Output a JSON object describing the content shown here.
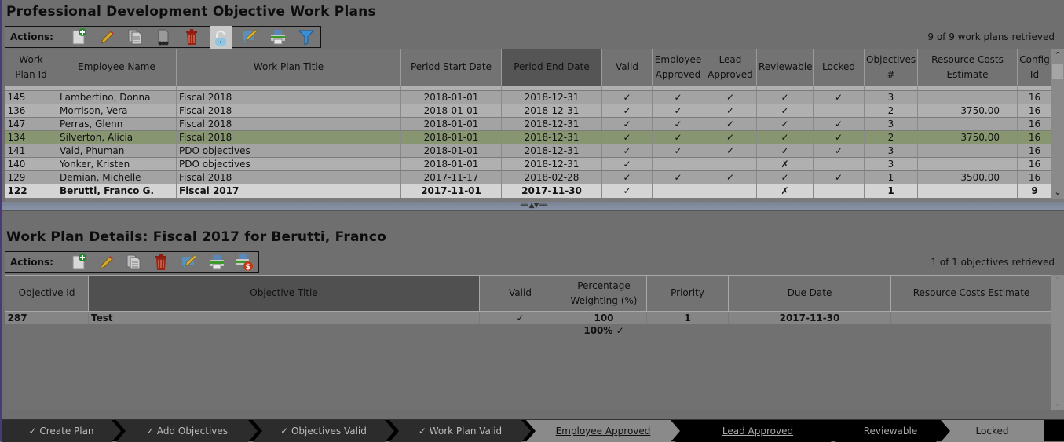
{
  "top": {
    "title": "Professional Development Objective Work Plans",
    "actions_label": "Actions:",
    "toolbar": [
      {
        "icon": "add-document-icon",
        "label": "Add"
      },
      {
        "icon": "pencil-icon",
        "label": "Edit"
      },
      {
        "icon": "copy-document-icon",
        "label": "Copy"
      },
      {
        "icon": "bulk-copy-icon",
        "label": "Bulk Copy"
      },
      {
        "icon": "trash-icon",
        "label": "Delete"
      },
      {
        "icon": "unlock-icon",
        "label": "Unlock"
      },
      {
        "icon": "comment-edit-icon",
        "label": "Review"
      },
      {
        "icon": "printer-icon",
        "label": "Print"
      },
      {
        "icon": "filter-icon",
        "label": "Filter"
      }
    ],
    "status": "9 of 9 work plans retrieved",
    "columns": [
      "Work Plan Id",
      "Employee Name",
      "Work Plan Title",
      "Period Start Date",
      "Period End Date",
      "Valid",
      "Employee Approved",
      "Lead Approved",
      "Reviewable",
      "Locked",
      "Objectives #",
      "Resource Costs Estimate",
      "Config Id"
    ],
    "sorted_column": "Period End Date",
    "rows": [
      {
        "id": "145",
        "name": "Lambertino, Donna",
        "title": "Fiscal 2018",
        "start": "2018-01-01",
        "end": "2018-12-31",
        "valid": "✓",
        "emp": "✓",
        "lead": "✓",
        "review": "✓",
        "locked": "✓",
        "obj": "3",
        "cost": "",
        "config": "16"
      },
      {
        "id": "136",
        "name": "Morrison, Vera",
        "title": "Fiscal 2018",
        "start": "2018-01-01",
        "end": "2018-12-31",
        "valid": "✓",
        "emp": "✓",
        "lead": "✓",
        "review": "✓",
        "locked": "",
        "obj": "2",
        "cost": "3750.00",
        "config": "16"
      },
      {
        "id": "147",
        "name": "Perras, Glenn",
        "title": "Fiscal 2018",
        "start": "2018-01-01",
        "end": "2018-12-31",
        "valid": "✓",
        "emp": "✓",
        "lead": "✓",
        "review": "✓",
        "locked": "✓",
        "obj": "3",
        "cost": "",
        "config": "16"
      },
      {
        "id": "134",
        "name": "Silverton, Alicia",
        "title": "Fiscal 2018",
        "start": "2018-01-01",
        "end": "2018-12-31",
        "valid": "✓",
        "emp": "✓",
        "lead": "✓",
        "review": "✓",
        "locked": "✓",
        "obj": "2",
        "cost": "3750.00",
        "config": "16"
      },
      {
        "id": "141",
        "name": "Vaid, Phuman",
        "title": "PDO objectives",
        "start": "2018-01-01",
        "end": "2018-12-31",
        "valid": "✓",
        "emp": "✓",
        "lead": "✓",
        "review": "✓",
        "locked": "✓",
        "obj": "3",
        "cost": "",
        "config": "16"
      },
      {
        "id": "140",
        "name": "Yonker, Kristen",
        "title": "PDO objectives",
        "start": "2018-01-01",
        "end": "2018-12-31",
        "valid": "✓",
        "emp": "",
        "lead": "",
        "review": "✗",
        "locked": "",
        "obj": "3",
        "cost": "",
        "config": "16"
      },
      {
        "id": "129",
        "name": "Demian, Michelle",
        "title": "Fiscal 2018",
        "start": "2017-11-17",
        "end": "2018-02-28",
        "valid": "✓",
        "emp": "✓",
        "lead": "✓",
        "review": "✓",
        "locked": "✓",
        "obj": "1",
        "cost": "3500.00",
        "config": "16"
      },
      {
        "id": "122",
        "name": "Berutti, Franco G.",
        "title": "Fiscal 2017",
        "start": "2017-11-01",
        "end": "2017-11-30",
        "valid": "✓",
        "emp": "",
        "lead": "",
        "review": "✗",
        "locked": "",
        "obj": "1",
        "cost": "",
        "config": "9"
      }
    ],
    "highlight_row_index": 3,
    "selected_row_index": 7
  },
  "details": {
    "title": "Work Plan Details: Fiscal 2017 for Berutti, Franco",
    "actions_label": "Actions:",
    "toolbar": [
      {
        "icon": "add-document-icon",
        "label": "Add"
      },
      {
        "icon": "pencil-icon",
        "label": "Edit"
      },
      {
        "icon": "copy-document-icon",
        "label": "Copy"
      },
      {
        "icon": "trash-icon",
        "label": "Delete"
      },
      {
        "icon": "comment-edit-icon",
        "label": "Review"
      },
      {
        "icon": "printer-icon",
        "label": "Print"
      },
      {
        "icon": "print-costs-icon",
        "label": "Print Costs"
      }
    ],
    "status": "1 of 1 objectives retrieved",
    "columns": [
      "Objective Id",
      "Objective Title",
      "Valid",
      "Percentage Weighting (%)",
      "Priority",
      "Due Date",
      "Resource Costs Estimate"
    ],
    "sorted_column": "Objective Title",
    "rows": [
      {
        "id": "287",
        "title": "Test",
        "valid": "✓",
        "weight": "100",
        "priority": "1",
        "due": "2017-11-30",
        "cost": ""
      }
    ],
    "weight_total": "100% ✓"
  },
  "workflow": [
    {
      "label": "✓ Create Plan",
      "state": "done"
    },
    {
      "label": "✓ Add Objectives",
      "state": "done"
    },
    {
      "label": "✓ Objectives Valid",
      "state": "done"
    },
    {
      "label": "✓ Work Plan Valid",
      "state": "done"
    },
    {
      "label": "Employee Approved",
      "state": "current-link"
    },
    {
      "label": "Lead Approved",
      "state": "pending-link"
    },
    {
      "label": "Reviewable",
      "state": "pending"
    },
    {
      "label": "Locked",
      "state": "future"
    }
  ],
  "colors": {
    "background": "#6f6f6f",
    "highlight_row": "#879670",
    "selected_row": "#d4d4d4",
    "sorted_header": "#555555"
  }
}
